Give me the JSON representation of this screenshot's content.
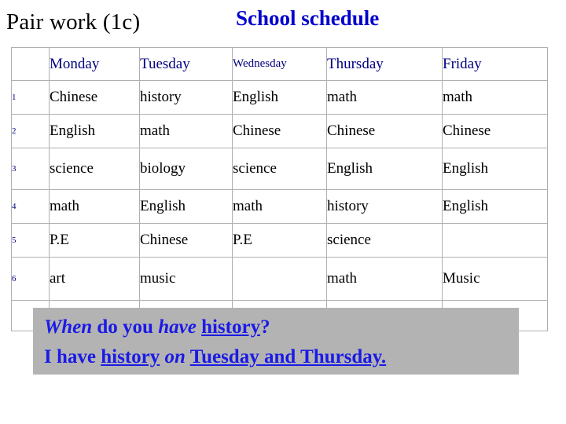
{
  "slide": {
    "title_left": "Pair work (1c)",
    "title_right": "School schedule"
  },
  "table": {
    "corner_label": "",
    "day_headers": [
      "Monday",
      "Tuesday",
      "Wednesday",
      "Thursday",
      "Friday"
    ],
    "row_numbers": [
      "1",
      "2",
      "3",
      "4",
      "5",
      "6"
    ],
    "rows": [
      {
        "num": "1",
        "monday": "Chinese",
        "tuesday": "history",
        "wednesday": "English",
        "thursday": "math",
        "friday": "math"
      },
      {
        "num": "2",
        "monday": "English",
        "tuesday": "math",
        "wednesday": "Chinese",
        "thursday": "Chinese",
        "friday": "Chinese"
      },
      {
        "num": "3",
        "monday": "science",
        "tuesday": "biology",
        "wednesday": "science",
        "thursday": "English",
        "friday": "English"
      },
      {
        "num": "4",
        "monday": "math",
        "tuesday": "English",
        "wednesday": "math",
        "thursday": "history",
        "friday": "English"
      },
      {
        "num": "5",
        "monday": "P.E",
        "tuesday": "Chinese",
        "wednesday": "P.E",
        "thursday": "science",
        "friday": ""
      },
      {
        "num": "6",
        "monday": "art",
        "tuesday": "music",
        "wednesday": "",
        "thursday": "math",
        "friday": "Music"
      }
    ]
  },
  "dialogue": {
    "line1": {
      "w1": "When",
      "w2": " do you ",
      "w3": "have",
      "w4": " ",
      "w5": "history",
      "w6": "?"
    },
    "line2": {
      "w1": "I have ",
      "w2": "history",
      "w3": " ",
      "w4": "on",
      "w5": " ",
      "w6": "Tuesday and Thursday."
    }
  },
  "colors": {
    "heading_blue": "#0000CC",
    "day_navy": "#000080",
    "dialogue_blue": "#1a1aE6",
    "dialogue_background": "#b3b3b3",
    "table_border": "#b0b0b0"
  }
}
